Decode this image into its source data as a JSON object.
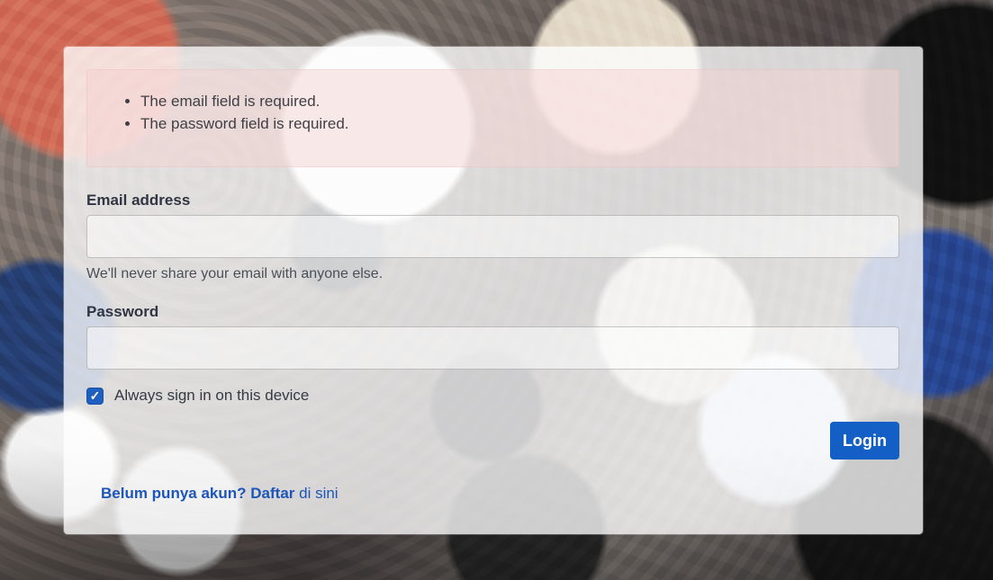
{
  "errors": {
    "items": [
      "The email field is required.",
      "The password field is required."
    ]
  },
  "form": {
    "email_label": "Email address",
    "email_value": "",
    "email_placeholder": "",
    "email_help": "We'll never share your email with anyone else.",
    "password_label": "Password",
    "password_value": "",
    "password_placeholder": "",
    "remember_label": "Always sign in on this device",
    "remember_checked": true,
    "login_label": "Login"
  },
  "signup": {
    "prefix": "Belum punya akun?",
    "link_text": "Daftar",
    "suffix": "di sini"
  },
  "colors": {
    "primary": "#145fc5",
    "link": "#1d56b8",
    "alert_background": "#f4d2d2"
  },
  "icons": {
    "checkbox": "check-icon"
  }
}
